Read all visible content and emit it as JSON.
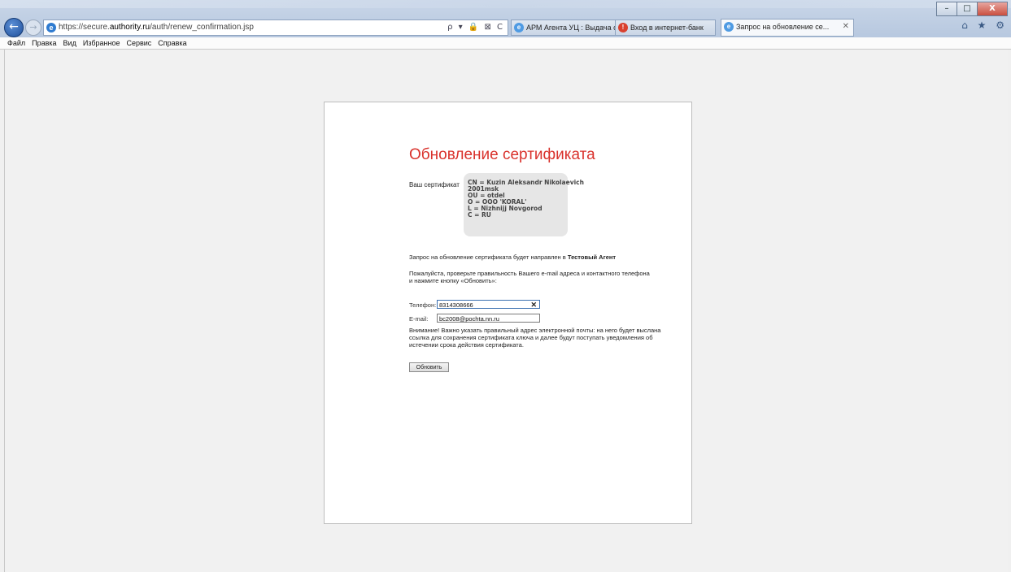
{
  "browser": {
    "address": {
      "prefix": "https://secure.",
      "domain": "authority.ru",
      "path": "/auth/renew_confirmation.jsp",
      "tools": "ρ ▾ 🔒 ⊠ C"
    },
    "tabs": [
      {
        "label": "АРМ Агента УЦ : Выдача серт..."
      },
      {
        "label": "Вход в интернет-банк"
      },
      {
        "label": "Запрос на обновление се..."
      }
    ],
    "window_controls": {
      "minimize": "–",
      "maximize": "□",
      "close": "X"
    },
    "right_icons": "⌂ ★ ⚙"
  },
  "menu": [
    "Файл",
    "Правка",
    "Вид",
    "Избранное",
    "Сервис",
    "Справка"
  ],
  "page": {
    "title": "Обновление сертификата",
    "cert_label": "Ваш сертификат",
    "cert_lines": "CN = Kuzin Aleksandr Nikolaevich\n2001msk\nOU = otdel\nO = OOO 'KORAL'\nL = Nizhnijj Novgorod\nC = RU",
    "request_text": "Запрос на обновление сертификата будет направлен в ",
    "request_agent": "Тестовый Агент",
    "check_text": "Пожалуйста, проверьте правильность Вашего e-mail адреса и контактного телефона и нажмите кнопку «Обновить»:",
    "phone_label": "Телефон:",
    "phone_value": "8314308666",
    "email_label": "E-mail:",
    "email_value": "bc2008@pochta.nn.ru",
    "warning_text": "Внимание! Важно указать правильный адрес электронной почты: на него будет выслана ссылка для сохранения сертификата ключа и далее будут поступать уведомления об истечении срока действия сертификата.",
    "submit_label": "Обновить"
  }
}
